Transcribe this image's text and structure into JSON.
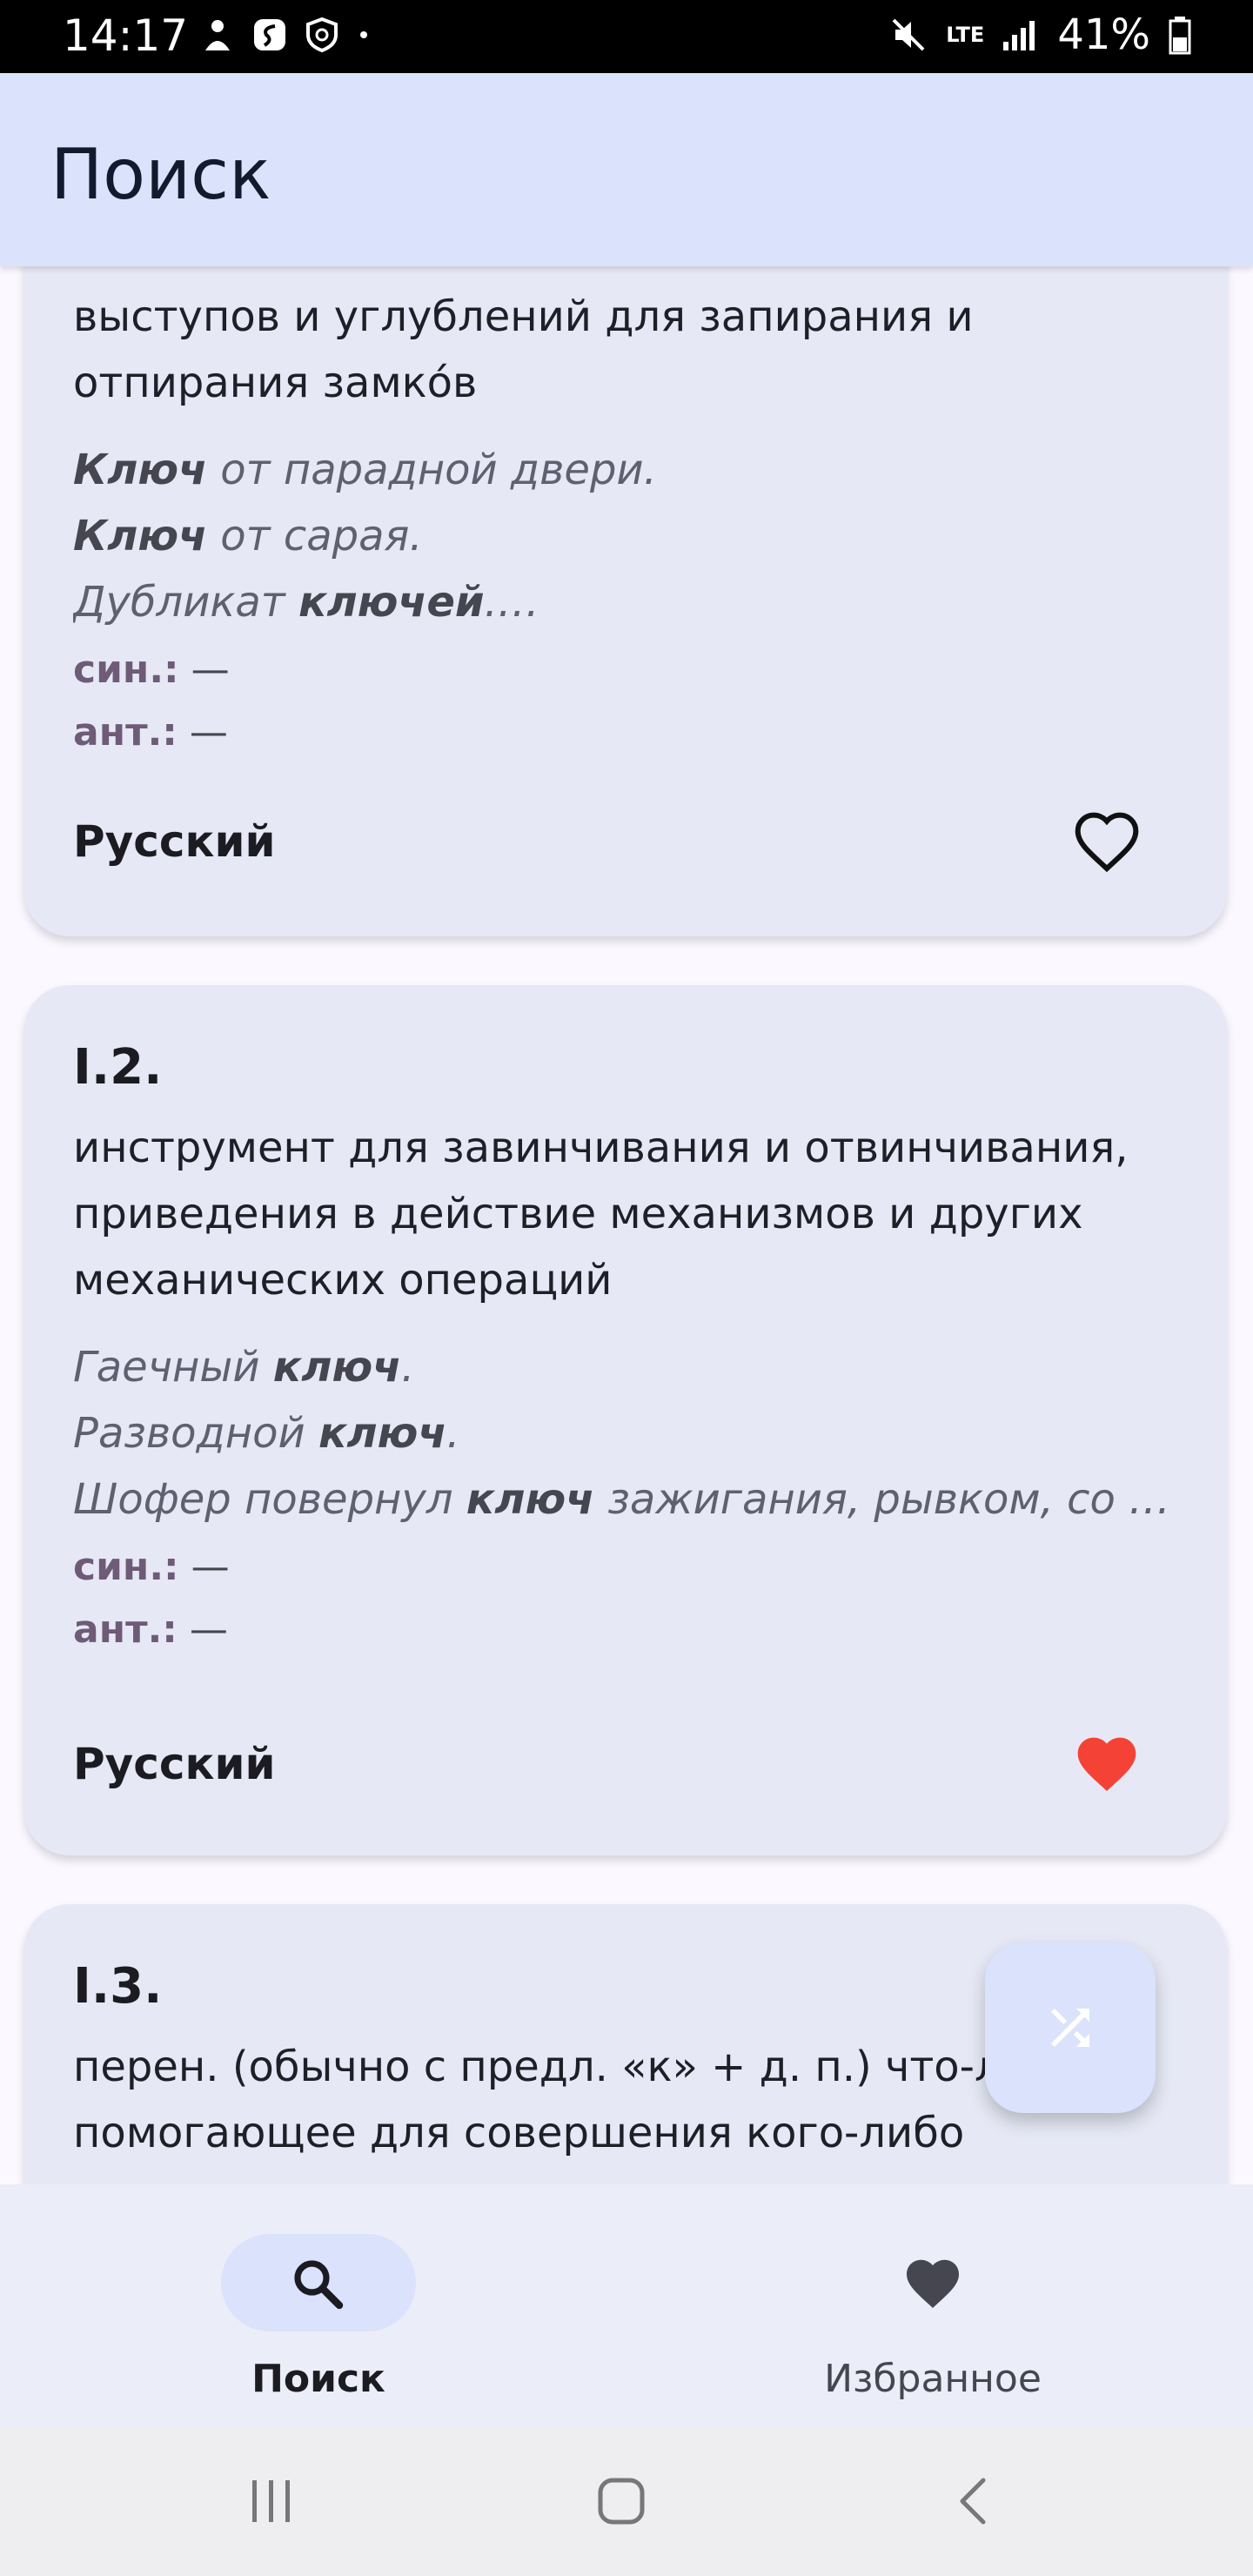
{
  "status": {
    "time": "14:17",
    "network": "LTE",
    "battery": "41%"
  },
  "appbar": {
    "title": "Поиск"
  },
  "cards": [
    {
      "definition_lines": [
        "выступов и углублений для запирания и",
        "отпирания замко́в"
      ],
      "examples": [
        {
          "bold": "Ключ",
          "rest": " от парадной двери."
        },
        {
          "bold": "Ключ",
          "rest": " от сарая."
        },
        {
          "pre": "Дубликат ",
          "bold": "ключей",
          "rest": ".…"
        }
      ],
      "syn_label": "син.:",
      "syn_value": "—",
      "ant_label": "ант.:",
      "ant_value": "—",
      "language": "Русский",
      "favorite": false
    },
    {
      "title": "I.2.",
      "definition_lines": [
        "инструмент для завинчивания и отвинчивания,",
        "приведения в действие механизмов и других",
        "механических операций"
      ],
      "examples": [
        {
          "pre": "Гаечный ",
          "bold": "ключ",
          "rest": "."
        },
        {
          "pre": "Разводной ",
          "bold": "ключ",
          "rest": "."
        },
        {
          "pre": "Шофер повернул ",
          "bold": "ключ",
          "rest": " зажигания, рывком, со зв…"
        }
      ],
      "syn_label": "син.:",
      "syn_value": "—",
      "ant_label": "ант.:",
      "ant_value": "—",
      "language": "Русский",
      "favorite": true
    },
    {
      "title": "I.3.",
      "definition_lines": [
        "перен. (обычно с предл. «к» + д. п.) что-л.",
        "помогающее для совершения кого-либо"
      ]
    }
  ],
  "fab": {
    "icon": "shuffle-icon"
  },
  "bottom_nav": {
    "items": [
      {
        "label": "Поиск",
        "icon": "search-icon",
        "active": true
      },
      {
        "label": "Избранное",
        "icon": "heart-icon",
        "active": false
      }
    ]
  },
  "colors": {
    "accent": "#dbe2fc",
    "favorite": "#f44336",
    "card": "#e6e9f5",
    "syn_label": "#6e5b78"
  }
}
